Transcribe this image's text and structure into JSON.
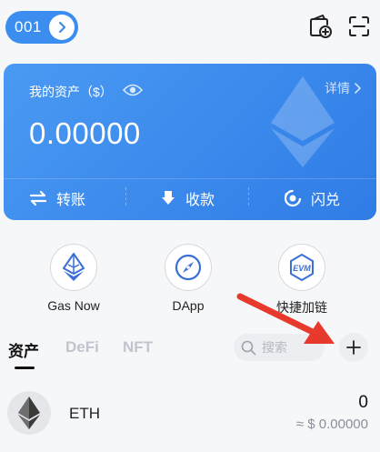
{
  "header": {
    "wallet_name": "001",
    "icons": [
      "chevron-right-icon",
      "add-wallet-icon",
      "scan-icon"
    ]
  },
  "asset_card": {
    "label": "我的资产（$）",
    "detail_label": "详情",
    "balance": "0.00000",
    "actions": [
      {
        "label": "转账",
        "icon": "transfer-icon"
      },
      {
        "label": "收款",
        "icon": "receive-icon"
      },
      {
        "label": "闪兑",
        "icon": "swap-icon"
      }
    ],
    "accent_color": "#3b8ef0"
  },
  "quick_entries": [
    {
      "label": "Gas Now",
      "icon": "gas-now-icon"
    },
    {
      "label": "DApp",
      "icon": "compass-icon"
    },
    {
      "label": "快捷加链",
      "icon": "evm-chain-icon",
      "badge": "EVM"
    }
  ],
  "tabs": [
    {
      "label": "资产",
      "active": true
    },
    {
      "label": "DeFi",
      "active": false
    },
    {
      "label": "NFT",
      "active": false
    }
  ],
  "search": {
    "placeholder": "搜索"
  },
  "tokens": [
    {
      "symbol": "ETH",
      "amount": "0",
      "value": "≈ $ 0.00000"
    }
  ],
  "annotation_color": "#e8392d"
}
